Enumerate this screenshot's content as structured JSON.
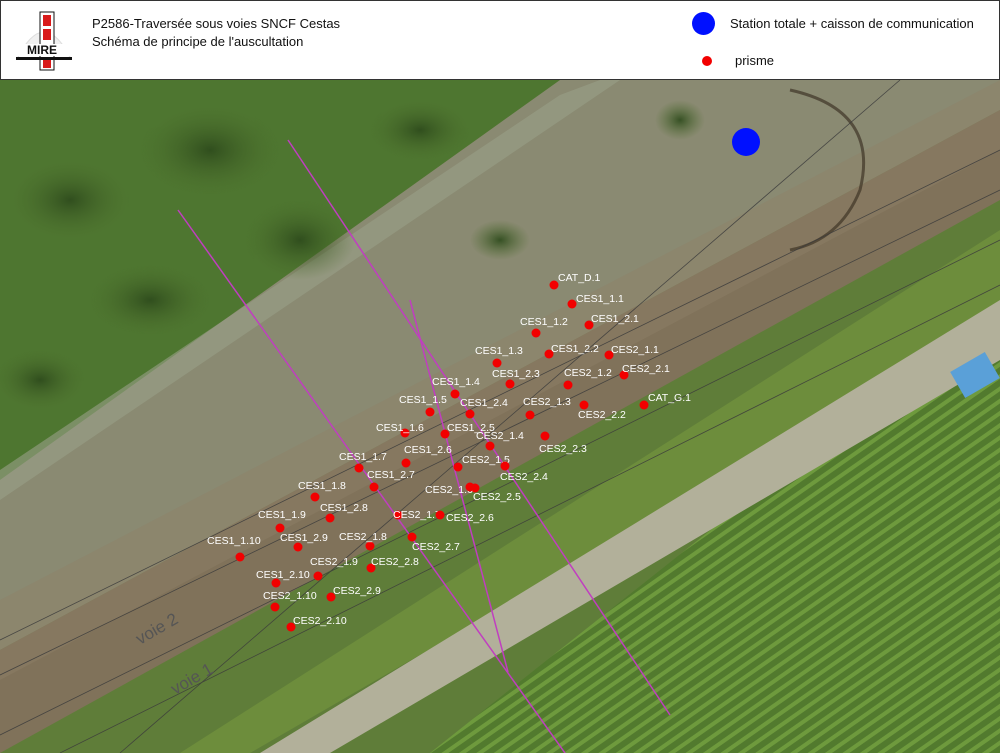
{
  "header": {
    "title": "P2586-Traversée sous voies SNCF Cestas",
    "subtitle": "Schéma de principe de l'auscultation",
    "logo_text": "MIRE"
  },
  "legend": {
    "station_label": "Station totale + caisson de communication",
    "prism_label": "prisme",
    "station_color": "#0010ff",
    "prism_color": "#f20000"
  },
  "tracks": {
    "voie2": "voie 2",
    "voie1": "voie 1"
  },
  "prisms": [
    "CAT_D.1",
    "CES1_1.1",
    "CES1_1.2",
    "CES1_2.1",
    "CES1_1.3",
    "CES1_2.2",
    "CES2_1.1",
    "CES1_1.4",
    "CES1_2.3",
    "CES2_1.2",
    "CES2_2.1",
    "CES1_1.5",
    "CES1_2.4",
    "CES2_1.3",
    "CAT_G.1",
    "CES2_2.2",
    "CES1_1.6",
    "CES1_2.5",
    "CES2_1.4",
    "CES2_2.3",
    "CES1_1.7",
    "CES1_2.6",
    "CES2_1.5",
    "CES2_2.4",
    "CES1_1.8",
    "CES1_2.7",
    "CES2_1.6",
    "CES2_2.5",
    "CES1_1.9",
    "CES1_2.8",
    "CES2_1.7",
    "CES2_2.6",
    "CES1_1.10",
    "CES1_2.9",
    "CES2_1.8",
    "CES2_2.7",
    "CES1_2.10",
    "CES2_1.9",
    "CES2_2.8",
    "CES2_1.10",
    "CES2_2.9",
    "CES2_2.10"
  ]
}
